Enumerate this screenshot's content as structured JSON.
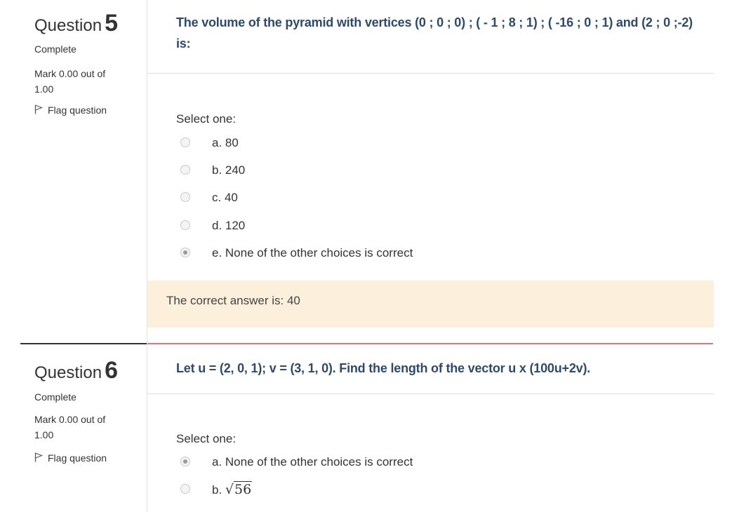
{
  "questions": [
    {
      "label": "Question",
      "number": "5",
      "state": "Complete",
      "mark": "Mark 0.00 out of 1.00",
      "flag_label": "Flag question",
      "text": "The volume of the pyramid with vertices (0 ; 0 ; 0) ; ( - 1 ; 8 ; 1) ; ( -16 ; 0 ; 1) and (2 ; 0 ;-2) is:",
      "prompt": "Select one:",
      "options": [
        {
          "label": "a. 80",
          "selected": false
        },
        {
          "label": "b. 240",
          "selected": false
        },
        {
          "label": "c. 40",
          "selected": false
        },
        {
          "label": "d. 120",
          "selected": false
        },
        {
          "label": "e. None of the other choices is correct",
          "selected": true
        }
      ],
      "feedback": "The correct answer is: 40"
    },
    {
      "label": "Question",
      "number": "6",
      "state": "Complete",
      "mark": "Mark 0.00 out of 1.00",
      "flag_label": "Flag question",
      "text": "Let u = (2, 0, 1); v = (3, 1, 0). Find the length of the vector u x (100u+2v).",
      "prompt": "Select one:",
      "options": [
        {
          "label": "a. None of the other choices is correct",
          "selected": true
        },
        {
          "label": "b.",
          "radicand": "56",
          "selected": false
        }
      ]
    }
  ],
  "colors": {
    "question_text": "#2d4a6b",
    "feedback_bg": "#fcefdc",
    "separator_accent": "#e8707a"
  },
  "icons": {
    "flag": "flag-icon"
  }
}
